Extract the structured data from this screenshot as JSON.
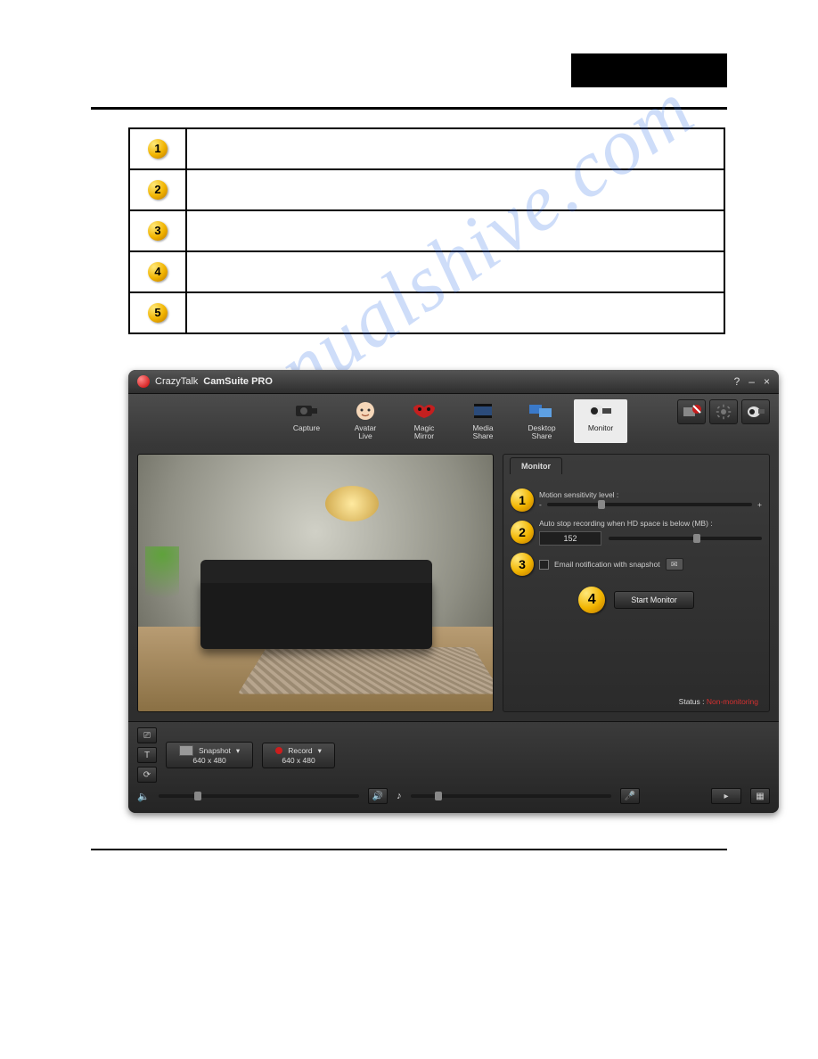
{
  "watermark_text": "manualshive.com",
  "table_rows": [
    "1",
    "2",
    "3",
    "4",
    "5"
  ],
  "app": {
    "brand1": "CrazyTalk",
    "brand2": "CamSuite PRO"
  },
  "win_controls": {
    "help": "?",
    "min": "–",
    "close": "×"
  },
  "toolbar": {
    "items": [
      {
        "label": "Capture"
      },
      {
        "label": "Avatar\nLive"
      },
      {
        "label": "Magic\nMirror"
      },
      {
        "label": "Media\nShare"
      },
      {
        "label": "Desktop\nShare"
      },
      {
        "label": "Monitor"
      }
    ]
  },
  "side": {
    "title": "Monitor",
    "row1": {
      "num": "1",
      "label": "Motion sensitivity level :",
      "minus": "-",
      "plus": "+"
    },
    "row2": {
      "num": "2",
      "label": "Auto stop recording when HD space is below (MB) :",
      "value": "152"
    },
    "row3": {
      "num": "3",
      "label": "Email notification with snapshot"
    },
    "row4": {
      "num": "4",
      "button": "Start Monitor"
    },
    "status_label": "Status :",
    "status_value": "Non-monitoring"
  },
  "footer": {
    "snapshot_label": "Snapshot",
    "record_label": "Record",
    "res1": "640 x 480",
    "res2": "640 x 480"
  }
}
